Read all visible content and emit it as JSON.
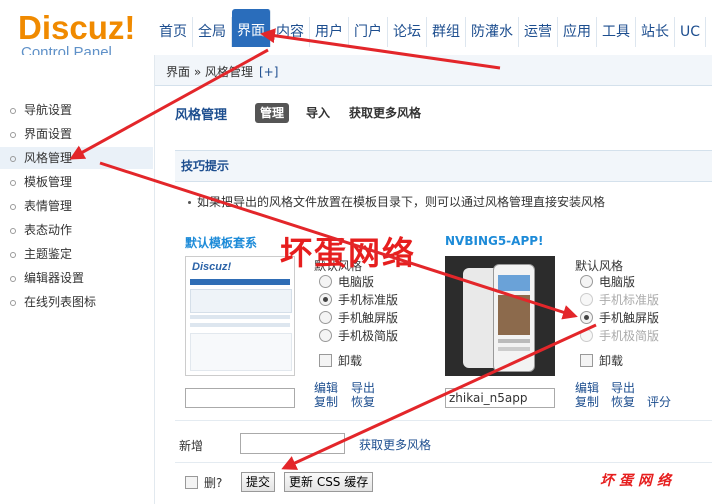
{
  "logo": {
    "brand": "Discuz!",
    "subtitle": "Control Panel"
  },
  "nav": [
    "首页",
    "全局",
    "界面",
    "内容",
    "用户",
    "门户",
    "论坛",
    "群组",
    "防灌水",
    "运营",
    "应用",
    "工具",
    "站长",
    "UC"
  ],
  "nav_active_index": 2,
  "breadcrumb": {
    "text": "界面 » 风格管理",
    "plus": "[+]"
  },
  "sidebar": [
    "导航设置",
    "界面设置",
    "风格管理",
    "模板管理",
    "表情管理",
    "表态动作",
    "主题鉴定",
    "编辑器设置",
    "在线列表图标"
  ],
  "sidebar_active_index": 2,
  "main": {
    "title": "风格管理",
    "tabs": [
      "管理",
      "导入",
      "获取更多风格"
    ],
    "tips_title": "技巧提示",
    "tip": "如果把导出的风格文件放置在模板目录下，则可以通过风格管理直接安装风格"
  },
  "templates": [
    {
      "name": "默认模板套系",
      "input_value": "",
      "default_label": "默认风格",
      "options": [
        {
          "label": "电脑版",
          "state": "off"
        },
        {
          "label": "手机标准版",
          "state": "on"
        },
        {
          "label": "手机触屏版",
          "state": "off"
        },
        {
          "label": "手机极简版",
          "state": "off"
        }
      ],
      "uninstall": "卸载",
      "links_row1": [
        "编辑",
        "导出"
      ],
      "links_row2": [
        "复制",
        "恢复"
      ]
    },
    {
      "name": "NVBING5-APP!",
      "input_value": "zhikai_n5app",
      "default_label": "默认风格",
      "options": [
        {
          "label": "电脑版",
          "state": "off"
        },
        {
          "label": "手机标准版",
          "state": "disabled"
        },
        {
          "label": "手机触屏版",
          "state": "on"
        },
        {
          "label": "手机极简版",
          "state": "disabled"
        }
      ],
      "uninstall": "卸载",
      "links_row1": [
        "编辑",
        "导出"
      ],
      "links_row2": [
        "复制",
        "恢复",
        "评分"
      ]
    }
  ],
  "new_row": {
    "label": "新增",
    "input_value": "",
    "link": "获取更多风格"
  },
  "footer": {
    "delete_label": "删?",
    "submit": "提交",
    "update_css": "更新 CSS 缓存"
  },
  "watermark": {
    "big": "坏蛋网络",
    "small": "坏蛋网络"
  },
  "thumb_logo": "Discuz!"
}
